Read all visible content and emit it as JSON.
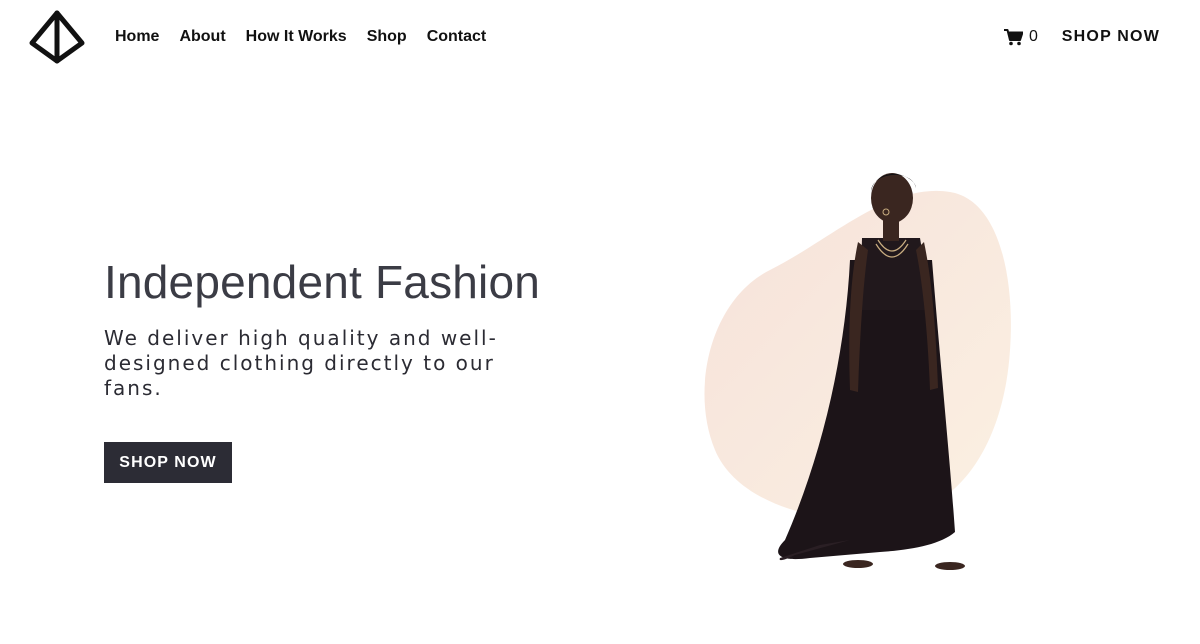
{
  "header": {
    "logo_icon": "diamond-logo-icon",
    "nav": [
      {
        "label": "Home"
      },
      {
        "label": "About"
      },
      {
        "label": "How It Works"
      },
      {
        "label": "Shop"
      },
      {
        "label": "Contact"
      }
    ],
    "cart": {
      "icon": "shopping-cart-icon",
      "count": "0"
    },
    "cta_label": "SHOP NOW"
  },
  "hero": {
    "title": "Independent Fashion",
    "subtitle": "We deliver high quality and well-designed clothing directly to our fans.",
    "button_label": "SHOP NOW",
    "image": "model-in-black-dress"
  },
  "colors": {
    "text_dark": "#111111",
    "title_gray": "#3b3c45",
    "button_bg": "#2c2c35",
    "blob_peach": "#f7e6dc",
    "background": "#ffffff"
  }
}
